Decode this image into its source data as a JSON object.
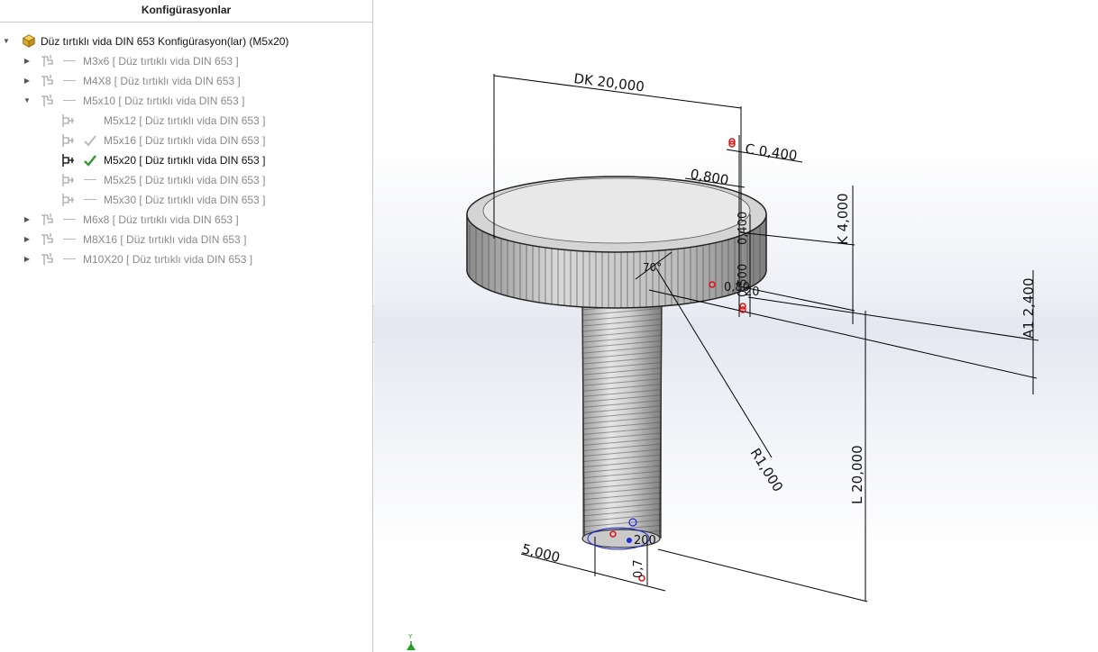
{
  "panel": {
    "title": "Konfigürasyonlar"
  },
  "tree": {
    "root_label": "Düz tırtıklı vida DIN 653 Konfigürasyon(lar)  (M5x20)",
    "items": [
      {
        "label": "M3x6 [ Düz tırtıklı vida DIN 653 ]"
      },
      {
        "label": "M4X8 [ Düz tırtıklı vida DIN 653 ]"
      },
      {
        "label": "M5x10 [ Düz tırtıklı vida DIN 653 ]"
      },
      {
        "label": "M5x12 [ Düz tırtıklı vida DIN 653 ]"
      },
      {
        "label": "M5x16 [ Düz tırtıklı vida DIN 653 ]"
      },
      {
        "label": "M5x20 [ Düz tırtıklı vida DIN 653 ]"
      },
      {
        "label": "M5x25 [ Düz tırtıklı vida DIN 653 ]"
      },
      {
        "label": "M5x30 [ Düz tırtıklı vida DIN 653 ]"
      },
      {
        "label": "M6x8 [ Düz tırtıklı vida DIN 653 ]"
      },
      {
        "label": "M8X16 [ Düz tırtıklı vida DIN 653 ]"
      },
      {
        "label": "M10X20 [ Düz tırtıklı vida DIN 653 ]"
      }
    ]
  },
  "viewport": {
    "dimensions": {
      "dk": "DK  20,000",
      "c": "C  0,400",
      "d0800": "0,800",
      "k": "K  4,000",
      "a1": "A1  2,400",
      "l": "L  20,000",
      "r": "R1,000",
      "d5": "5,000",
      "angle": "70°",
      "d0400": "0,400",
      "d0500": "0,500",
      "d07": "0,7",
      "d200": "200",
      "d20": "20",
      "dg": "0,80"
    },
    "triad_axis": "Y"
  },
  "colors": {
    "active_check": "#2e9a2e",
    "dim_check": "#b8b8b8",
    "config_icon": "#e7b43a",
    "dimension_line": "#000000"
  }
}
